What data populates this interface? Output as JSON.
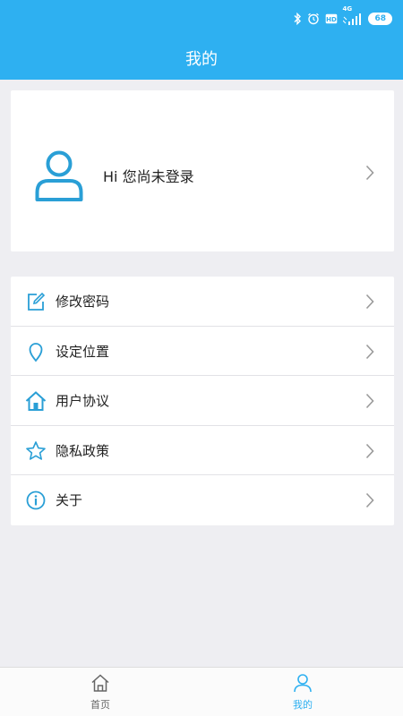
{
  "status_bar": {
    "network": "4G",
    "battery": "68",
    "icons": [
      "bluetooth-icon",
      "alarm-icon",
      "hd-icon",
      "signal-icon",
      "battery-icon"
    ]
  },
  "header": {
    "title": "我的"
  },
  "profile": {
    "greeting": "Hi 您尚未登录",
    "icon": "user-avatar-icon"
  },
  "menu": {
    "items": [
      {
        "label": "修改密码",
        "icon": "edit-icon"
      },
      {
        "label": "设定位置",
        "icon": "location-pin-icon"
      },
      {
        "label": "用户协议",
        "icon": "home-icon"
      },
      {
        "label": "隐私政策",
        "icon": "star-icon"
      },
      {
        "label": "关于",
        "icon": "info-icon"
      }
    ]
  },
  "bottom_nav": {
    "items": [
      {
        "label": "首页",
        "icon": "home-icon",
        "active": false
      },
      {
        "label": "我的",
        "icon": "person-icon",
        "active": true
      }
    ]
  },
  "colors": {
    "primary": "#2eb0f1",
    "icon": "#2a9fd6",
    "background": "#eeeef2",
    "chevron": "#9a9a9a",
    "inactive_nav": "#666666"
  }
}
